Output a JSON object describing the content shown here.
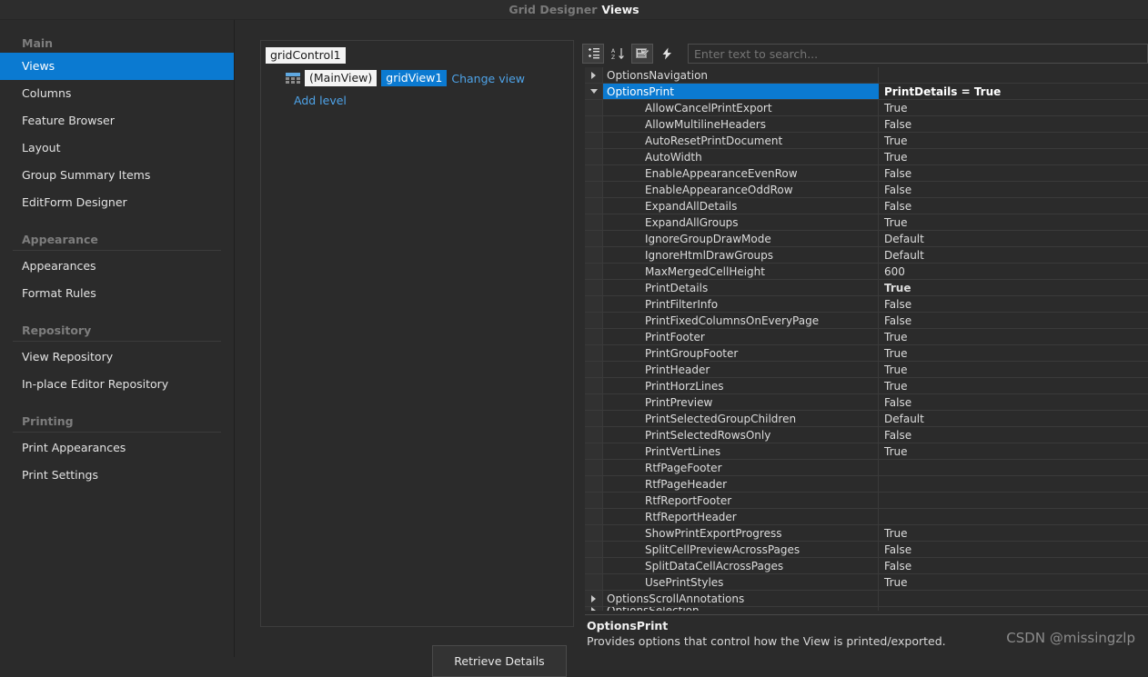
{
  "titlebar": {
    "app": "Grid Designer",
    "page": "Views"
  },
  "sidebar": {
    "groups": [
      {
        "title": "Main",
        "show_sep": false,
        "items": [
          {
            "label": "Views",
            "selected": true
          },
          {
            "label": "Columns",
            "selected": false
          },
          {
            "label": "Feature Browser",
            "selected": false
          },
          {
            "label": "Layout",
            "selected": false
          },
          {
            "label": "Group Summary Items",
            "selected": false
          },
          {
            "label": "EditForm Designer",
            "selected": false
          }
        ]
      },
      {
        "title": "Appearance",
        "show_sep": true,
        "items": [
          {
            "label": "Appearances",
            "selected": false
          },
          {
            "label": "Format Rules",
            "selected": false
          }
        ]
      },
      {
        "title": "Repository",
        "show_sep": true,
        "items": [
          {
            "label": "View Repository",
            "selected": false
          },
          {
            "label": "In-place Editor Repository",
            "selected": false
          }
        ]
      },
      {
        "title": "Printing",
        "show_sep": true,
        "items": [
          {
            "label": "Print Appearances",
            "selected": false
          },
          {
            "label": "Print Settings",
            "selected": false
          }
        ]
      }
    ]
  },
  "tree": {
    "root_label": "gridControl1",
    "level_icon": "grid-icon",
    "view_kind": "(MainView)",
    "view_name": "gridView1",
    "change_view_link": "Change view",
    "add_level_link": "Add level"
  },
  "middle": {
    "retrieve_button": "Retrieve Details"
  },
  "toolbar": {
    "buttons": [
      {
        "icon": "categorized-list-icon",
        "active": true
      },
      {
        "icon": "sort-alphabetical-icon",
        "active": false
      },
      {
        "icon": "property-pages-icon",
        "active": true
      },
      {
        "icon": "lightning-events-icon",
        "active": false
      }
    ],
    "search_placeholder": "Enter text to search...",
    "search_value": ""
  },
  "property_grid": {
    "rows": [
      {
        "name": "OptionsNavigation",
        "value": "",
        "indent": 0,
        "expander": "right",
        "selected": false,
        "bold_value": false
      },
      {
        "name": "OptionsPrint",
        "value": "PrintDetails = True",
        "indent": 0,
        "expander": "down",
        "selected": true,
        "bold_value": true
      },
      {
        "name": "AllowCancelPrintExport",
        "value": "True",
        "indent": 1,
        "expander": "",
        "selected": false,
        "bold_value": false
      },
      {
        "name": "AllowMultilineHeaders",
        "value": "False",
        "indent": 1,
        "expander": "",
        "selected": false,
        "bold_value": false
      },
      {
        "name": "AutoResetPrintDocument",
        "value": "True",
        "indent": 1,
        "expander": "",
        "selected": false,
        "bold_value": false
      },
      {
        "name": "AutoWidth",
        "value": "True",
        "indent": 1,
        "expander": "",
        "selected": false,
        "bold_value": false
      },
      {
        "name": "EnableAppearanceEvenRow",
        "value": "False",
        "indent": 1,
        "expander": "",
        "selected": false,
        "bold_value": false
      },
      {
        "name": "EnableAppearanceOddRow",
        "value": "False",
        "indent": 1,
        "expander": "",
        "selected": false,
        "bold_value": false
      },
      {
        "name": "ExpandAllDetails",
        "value": "False",
        "indent": 1,
        "expander": "",
        "selected": false,
        "bold_value": false
      },
      {
        "name": "ExpandAllGroups",
        "value": "True",
        "indent": 1,
        "expander": "",
        "selected": false,
        "bold_value": false
      },
      {
        "name": "IgnoreGroupDrawMode",
        "value": "Default",
        "indent": 1,
        "expander": "",
        "selected": false,
        "bold_value": false
      },
      {
        "name": "IgnoreHtmlDrawGroups",
        "value": "Default",
        "indent": 1,
        "expander": "",
        "selected": false,
        "bold_value": false
      },
      {
        "name": "MaxMergedCellHeight",
        "value": "600",
        "indent": 1,
        "expander": "",
        "selected": false,
        "bold_value": false
      },
      {
        "name": "PrintDetails",
        "value": "True",
        "indent": 1,
        "expander": "",
        "selected": false,
        "bold_value": true
      },
      {
        "name": "PrintFilterInfo",
        "value": "False",
        "indent": 1,
        "expander": "",
        "selected": false,
        "bold_value": false
      },
      {
        "name": "PrintFixedColumnsOnEveryPage",
        "value": "False",
        "indent": 1,
        "expander": "",
        "selected": false,
        "bold_value": false
      },
      {
        "name": "PrintFooter",
        "value": "True",
        "indent": 1,
        "expander": "",
        "selected": false,
        "bold_value": false
      },
      {
        "name": "PrintGroupFooter",
        "value": "True",
        "indent": 1,
        "expander": "",
        "selected": false,
        "bold_value": false
      },
      {
        "name": "PrintHeader",
        "value": "True",
        "indent": 1,
        "expander": "",
        "selected": false,
        "bold_value": false
      },
      {
        "name": "PrintHorzLines",
        "value": "True",
        "indent": 1,
        "expander": "",
        "selected": false,
        "bold_value": false
      },
      {
        "name": "PrintPreview",
        "value": "False",
        "indent": 1,
        "expander": "",
        "selected": false,
        "bold_value": false
      },
      {
        "name": "PrintSelectedGroupChildren",
        "value": "Default",
        "indent": 1,
        "expander": "",
        "selected": false,
        "bold_value": false
      },
      {
        "name": "PrintSelectedRowsOnly",
        "value": "False",
        "indent": 1,
        "expander": "",
        "selected": false,
        "bold_value": false
      },
      {
        "name": "PrintVertLines",
        "value": "True",
        "indent": 1,
        "expander": "",
        "selected": false,
        "bold_value": false
      },
      {
        "name": "RtfPageFooter",
        "value": "",
        "indent": 1,
        "expander": "",
        "selected": false,
        "bold_value": false
      },
      {
        "name": "RtfPageHeader",
        "value": "",
        "indent": 1,
        "expander": "",
        "selected": false,
        "bold_value": false
      },
      {
        "name": "RtfReportFooter",
        "value": "",
        "indent": 1,
        "expander": "",
        "selected": false,
        "bold_value": false
      },
      {
        "name": "RtfReportHeader",
        "value": "",
        "indent": 1,
        "expander": "",
        "selected": false,
        "bold_value": false
      },
      {
        "name": "ShowPrintExportProgress",
        "value": "True",
        "indent": 1,
        "expander": "",
        "selected": false,
        "bold_value": false
      },
      {
        "name": "SplitCellPreviewAcrossPages",
        "value": "False",
        "indent": 1,
        "expander": "",
        "selected": false,
        "bold_value": false
      },
      {
        "name": "SplitDataCellAcrossPages",
        "value": "False",
        "indent": 1,
        "expander": "",
        "selected": false,
        "bold_value": false
      },
      {
        "name": "UsePrintStyles",
        "value": "True",
        "indent": 1,
        "expander": "",
        "selected": false,
        "bold_value": false
      },
      {
        "name": "OptionsScrollAnnotations",
        "value": "",
        "indent": 0,
        "expander": "right",
        "selected": false,
        "bold_value": false
      },
      {
        "name": "OptionsSelection",
        "value": "",
        "indent": 0,
        "expander": "right",
        "selected": false,
        "bold_value": false,
        "partial": true
      }
    ]
  },
  "description": {
    "title": "OptionsPrint",
    "text": "Provides options that control how the View is printed/exported."
  },
  "watermark": "CSDN @missingzlp",
  "colors": {
    "accent": "#0b7ad1",
    "background": "#2b2b2b",
    "titlebar": "#2d2d2d",
    "link": "#4ea3e8",
    "grid_line": "#3a3a3a"
  }
}
